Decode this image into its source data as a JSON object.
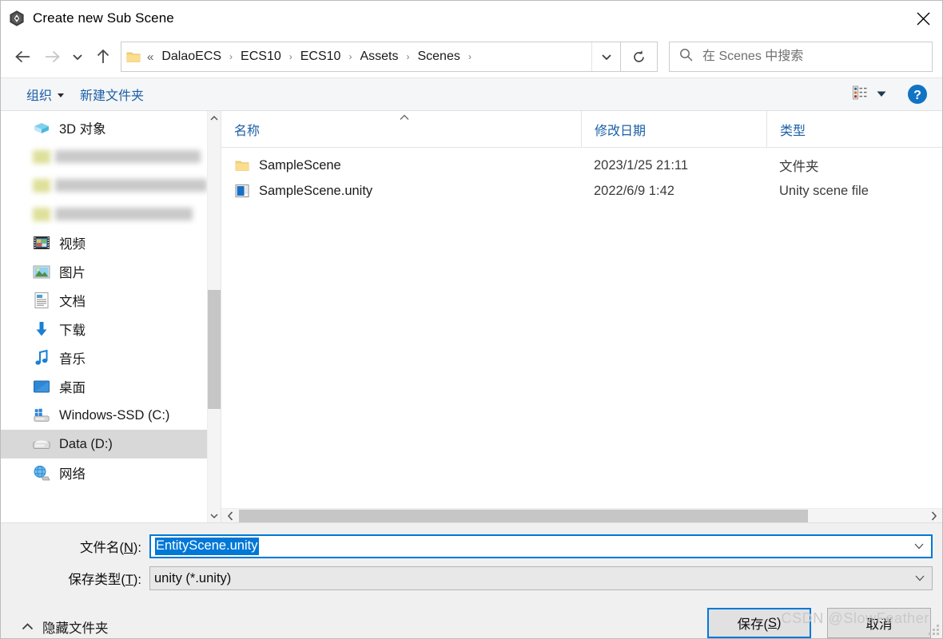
{
  "window": {
    "title": "Create new Sub Scene",
    "app_icon": "unity-icon",
    "close_label": "✕"
  },
  "nav": {
    "back_icon": "arrow-left-icon",
    "forward_icon": "arrow-right-icon",
    "recent_icon": "chevron-down-icon",
    "up_icon": "arrow-up-icon",
    "refresh_icon": "refresh-icon",
    "breadcrumb_overflow": "«",
    "breadcrumb": [
      "DalaoECS",
      "ECS10",
      "ECS10",
      "Assets",
      "Scenes"
    ],
    "breadcrumb_separator": "›",
    "dropdown_icon": "chevron-down-icon"
  },
  "search": {
    "placeholder": "在 Scenes 中搜索",
    "value": "",
    "icon": "search-icon"
  },
  "toolbar": {
    "organize_label": "组织",
    "new_folder_label": "新建文件夹",
    "view_icon": "details-view-icon",
    "view_caret_icon": "caret-down-icon",
    "help_icon": "help-icon"
  },
  "tree": {
    "items": [
      {
        "label": "3D 对象",
        "icon": "3d-objects-icon",
        "selected": false,
        "redacted": false
      },
      {
        "label": "",
        "icon": "",
        "selected": false,
        "redacted": true
      },
      {
        "label": "",
        "icon": "",
        "selected": false,
        "redacted": true
      },
      {
        "label": "",
        "icon": "",
        "selected": false,
        "redacted": true
      },
      {
        "label": "视频",
        "icon": "videos-icon",
        "selected": false,
        "redacted": false
      },
      {
        "label": "图片",
        "icon": "pictures-icon",
        "selected": false,
        "redacted": false
      },
      {
        "label": "文档",
        "icon": "documents-icon",
        "selected": false,
        "redacted": false
      },
      {
        "label": "下载",
        "icon": "downloads-icon",
        "selected": false,
        "redacted": false
      },
      {
        "label": "音乐",
        "icon": "music-icon",
        "selected": false,
        "redacted": false
      },
      {
        "label": "桌面",
        "icon": "desktop-icon",
        "selected": false,
        "redacted": false
      },
      {
        "label": "Windows-SSD (C:)",
        "icon": "windows-drive-icon",
        "selected": false,
        "redacted": false
      },
      {
        "label": "Data (D:)",
        "icon": "drive-icon",
        "selected": true,
        "redacted": false
      },
      {
        "label": "网络",
        "icon": "network-icon",
        "selected": false,
        "redacted": false
      }
    ]
  },
  "file_list": {
    "columns": [
      {
        "key": "name",
        "label": "名称",
        "sorted": true,
        "sort_dir": "asc"
      },
      {
        "key": "date",
        "label": "修改日期",
        "sorted": false,
        "sort_dir": ""
      },
      {
        "key": "type",
        "label": "类型",
        "sorted": false,
        "sort_dir": ""
      }
    ],
    "rows": [
      {
        "name": "SampleScene",
        "date": "2023/1/25 21:11",
        "type": "文件夹",
        "icon": "folder-icon"
      },
      {
        "name": "SampleScene.unity",
        "date": "2022/6/9 1:42",
        "type": "Unity scene file",
        "icon": "unity-scene-file-icon"
      }
    ]
  },
  "form": {
    "filename_label_pre": "文件名(",
    "filename_label_key": "N",
    "filename_label_post": "):",
    "filename_value": "EntityScene.unity",
    "filetype_label_pre": "保存类型(",
    "filetype_label_key": "T",
    "filetype_label_post": "):",
    "filetype_value": "unity (*.unity)"
  },
  "footer": {
    "hide_folders_label": "隐藏文件夹",
    "hide_folders_icon": "chevron-up-icon",
    "save_label_pre": "保存(",
    "save_label_key": "S",
    "save_label_post": ")",
    "cancel_label": "取消"
  },
  "watermark": {
    "text": "CSDN @SlowFeather"
  },
  "colors": {
    "accent": "#0078d7",
    "link": "#1b5fa8",
    "selection_bg": "#d8d8d8",
    "toolbar_bg": "#f5f6f7",
    "footer_bg": "#f0f0f0",
    "folder_yellow": "#f6d37a"
  }
}
